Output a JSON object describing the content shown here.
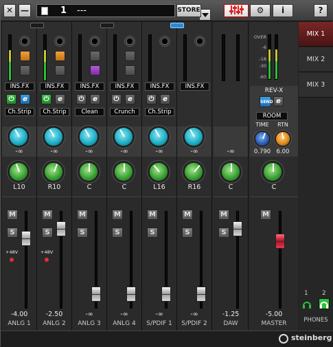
{
  "toolbar": {
    "close_label": "✕",
    "minimize_label": "—",
    "preset_number": "1",
    "preset_name": "---",
    "store_label": "STORE",
    "help_label": "?"
  },
  "tabs": [
    "MIX 1",
    "MIX 2",
    "MIX 3"
  ],
  "channels": [
    {
      "ins_fx": "INS.FX",
      "fx_name": "Ch.Strip",
      "send_value": "-∞",
      "pan": "L10",
      "fader_value": "-4.00",
      "name": "ANLG 1",
      "phantom": "+48V"
    },
    {
      "ins_fx": "INS.FX",
      "fx_name": "Ch.Strip",
      "send_value": "-∞",
      "pan": "R10",
      "fader_value": "-2.50",
      "name": "ANLG 2",
      "phantom": "+48V"
    },
    {
      "ins_fx": "INS.FX",
      "fx_name": "Clean",
      "send_value": "-∞",
      "pan": "C",
      "fader_value": "-∞",
      "name": "ANLG 3"
    },
    {
      "ins_fx": "INS.FX",
      "fx_name": "Crunch",
      "send_value": "-∞",
      "pan": "C",
      "fader_value": "-∞",
      "name": "ANLG 4"
    },
    {
      "ins_fx": "INS.FX",
      "fx_name": "Ch.Strip",
      "send_value": "-∞",
      "pan": "L16",
      "fader_value": "-∞",
      "name": "S/PDIF 1"
    },
    {
      "ins_fx": "INS.FX",
      "send_value": "-∞",
      "pan": "R16",
      "fader_value": "-∞",
      "name": "S/PDIF 2"
    }
  ],
  "daw": {
    "send_value": "-∞",
    "pan": "C",
    "fader_value": "-1.25",
    "name": "DAW"
  },
  "master": {
    "meter_scale": [
      "OVER",
      "-6",
      "-18",
      "-30",
      "-60"
    ],
    "rev_title": "REV-X",
    "send_label": "SEND",
    "room_label": "ROOM",
    "time_label": "TIME",
    "rtn_label": "RTN",
    "time_value": "0.790",
    "rtn_value": "6.00",
    "pan": "C",
    "fader_value": "-5.00",
    "name": "MASTER"
  },
  "phones": {
    "label": "PHONES",
    "ch1": "1",
    "ch2": "2"
  },
  "brand": "steinberg",
  "colors": {
    "accent_red": "#b0102a",
    "send_knob": "#1eb0c8",
    "pan_knob": "#3aa336"
  }
}
